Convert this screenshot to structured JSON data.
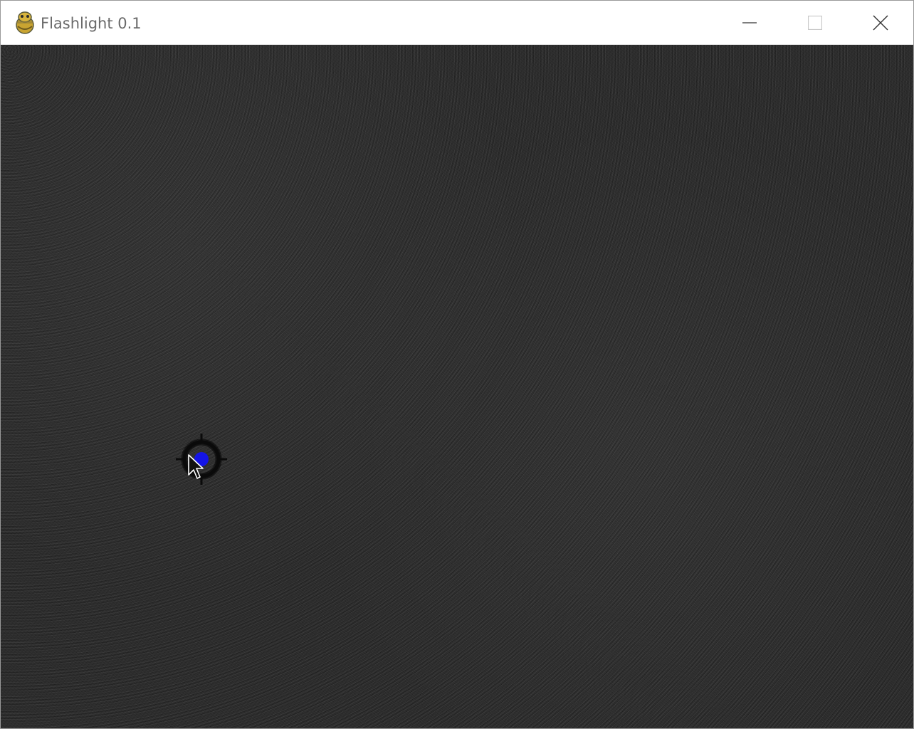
{
  "window": {
    "title": "Flashlight 0.1",
    "app_icon": "pygame-snake-icon",
    "controls": {
      "minimize_icon": "minimize-icon",
      "maximize_icon": "maximize-icon",
      "close_icon": "close-icon"
    }
  },
  "game": {
    "background": "dark-textured-fabric",
    "player": {
      "icon": "crosshair-icon",
      "dot_color": "#1414e6"
    },
    "mouse_cursor": "arrow-cursor-icon"
  }
}
